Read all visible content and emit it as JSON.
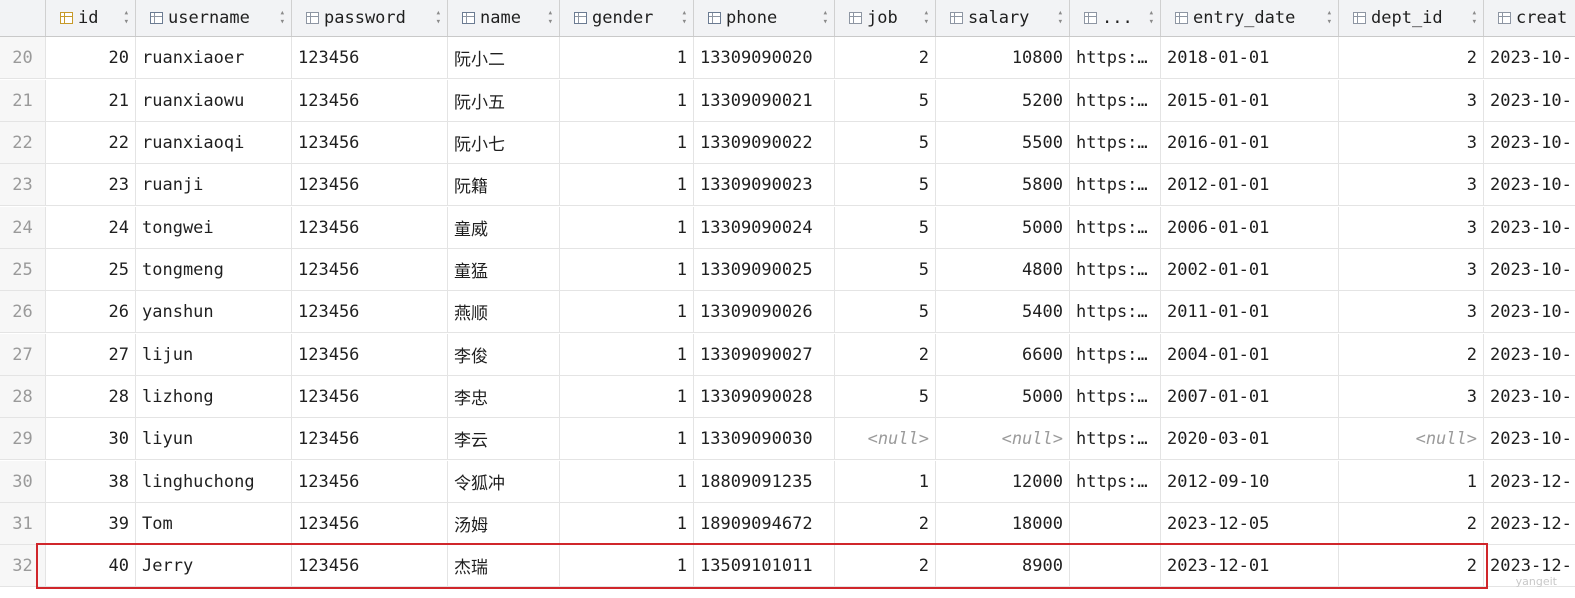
{
  "columns": [
    {
      "key": "id",
      "label": "id",
      "icon": "key-column-icon",
      "align": "right"
    },
    {
      "key": "username",
      "label": "username",
      "icon": "index-column-icon",
      "align": "left"
    },
    {
      "key": "password",
      "label": "password",
      "icon": "column-icon",
      "align": "left"
    },
    {
      "key": "name",
      "label": "name",
      "icon": "index-column-icon",
      "align": "left"
    },
    {
      "key": "gender",
      "label": "gender",
      "icon": "index-column-icon",
      "align": "right"
    },
    {
      "key": "phone",
      "label": "phone",
      "icon": "index-column-icon",
      "align": "left"
    },
    {
      "key": "job",
      "label": "job",
      "icon": "column-icon",
      "align": "right"
    },
    {
      "key": "salary",
      "label": "salary",
      "icon": "column-icon",
      "align": "right"
    },
    {
      "key": "image",
      "label": "...",
      "icon": "column-icon",
      "align": "left"
    },
    {
      "key": "entry_date",
      "label": "entry_date",
      "icon": "column-icon",
      "align": "left"
    },
    {
      "key": "dept_id",
      "label": "dept_id",
      "icon": "column-icon",
      "align": "right"
    },
    {
      "key": "create_time",
      "label": "creat",
      "icon": "column-icon",
      "align": "left"
    }
  ],
  "null_text": "<null>",
  "rows": [
    {
      "rownum": "20",
      "cells": [
        "20",
        "ruanxiaoer",
        "123456",
        "阮小二",
        "1",
        "13309090020",
        "2",
        "10800",
        "https:…",
        "2018-01-01",
        "2",
        "2023-10-"
      ]
    },
    {
      "rownum": "21",
      "cells": [
        "21",
        "ruanxiaowu",
        "123456",
        "阮小五",
        "1",
        "13309090021",
        "5",
        "5200",
        "https:…",
        "2015-01-01",
        "3",
        "2023-10-"
      ]
    },
    {
      "rownum": "22",
      "cells": [
        "22",
        "ruanxiaoqi",
        "123456",
        "阮小七",
        "1",
        "13309090022",
        "5",
        "5500",
        "https:…",
        "2016-01-01",
        "3",
        "2023-10-"
      ]
    },
    {
      "rownum": "23",
      "cells": [
        "23",
        "ruanji",
        "123456",
        "阮籍",
        "1",
        "13309090023",
        "5",
        "5800",
        "https:…",
        "2012-01-01",
        "3",
        "2023-10-"
      ]
    },
    {
      "rownum": "24",
      "cells": [
        "24",
        "tongwei",
        "123456",
        "童威",
        "1",
        "13309090024",
        "5",
        "5000",
        "https:…",
        "2006-01-01",
        "3",
        "2023-10-"
      ]
    },
    {
      "rownum": "25",
      "cells": [
        "25",
        "tongmeng",
        "123456",
        "童猛",
        "1",
        "13309090025",
        "5",
        "4800",
        "https:…",
        "2002-01-01",
        "3",
        "2023-10-"
      ]
    },
    {
      "rownum": "26",
      "cells": [
        "26",
        "yanshun",
        "123456",
        "燕顺",
        "1",
        "13309090026",
        "5",
        "5400",
        "https:…",
        "2011-01-01",
        "3",
        "2023-10-"
      ]
    },
    {
      "rownum": "27",
      "cells": [
        "27",
        "lijun",
        "123456",
        "李俊",
        "1",
        "13309090027",
        "2",
        "6600",
        "https:…",
        "2004-01-01",
        "2",
        "2023-10-"
      ]
    },
    {
      "rownum": "28",
      "cells": [
        "28",
        "lizhong",
        "123456",
        "李忠",
        "1",
        "13309090028",
        "5",
        "5000",
        "https:…",
        "2007-01-01",
        "3",
        "2023-10-"
      ]
    },
    {
      "rownum": "29",
      "cells": [
        "30",
        "liyun",
        "123456",
        "李云",
        "1",
        "13309090030",
        null,
        null,
        "https:…",
        "2020-03-01",
        null,
        "2023-10-"
      ]
    },
    {
      "rownum": "30",
      "cells": [
        "38",
        "linghuchong",
        "123456",
        "令狐冲",
        "1",
        "18809091235",
        "1",
        "12000",
        "https:…",
        "2012-09-10",
        "1",
        "2023-12-"
      ]
    },
    {
      "rownum": "31",
      "cells": [
        "39",
        "Tom",
        "123456",
        "汤姆",
        "1",
        "18909094672",
        "2",
        "18000",
        "",
        "2023-12-05",
        "2",
        "2023-12-"
      ]
    },
    {
      "rownum": "32",
      "cells": [
        "40",
        "Jerry",
        "123456",
        "杰瑞",
        "1",
        "13509101011",
        "2",
        "8900",
        "",
        "2023-12-01",
        "2",
        "2023-12-"
      ]
    }
  ],
  "highlighted_row": "32",
  "watermark": "yangeit"
}
